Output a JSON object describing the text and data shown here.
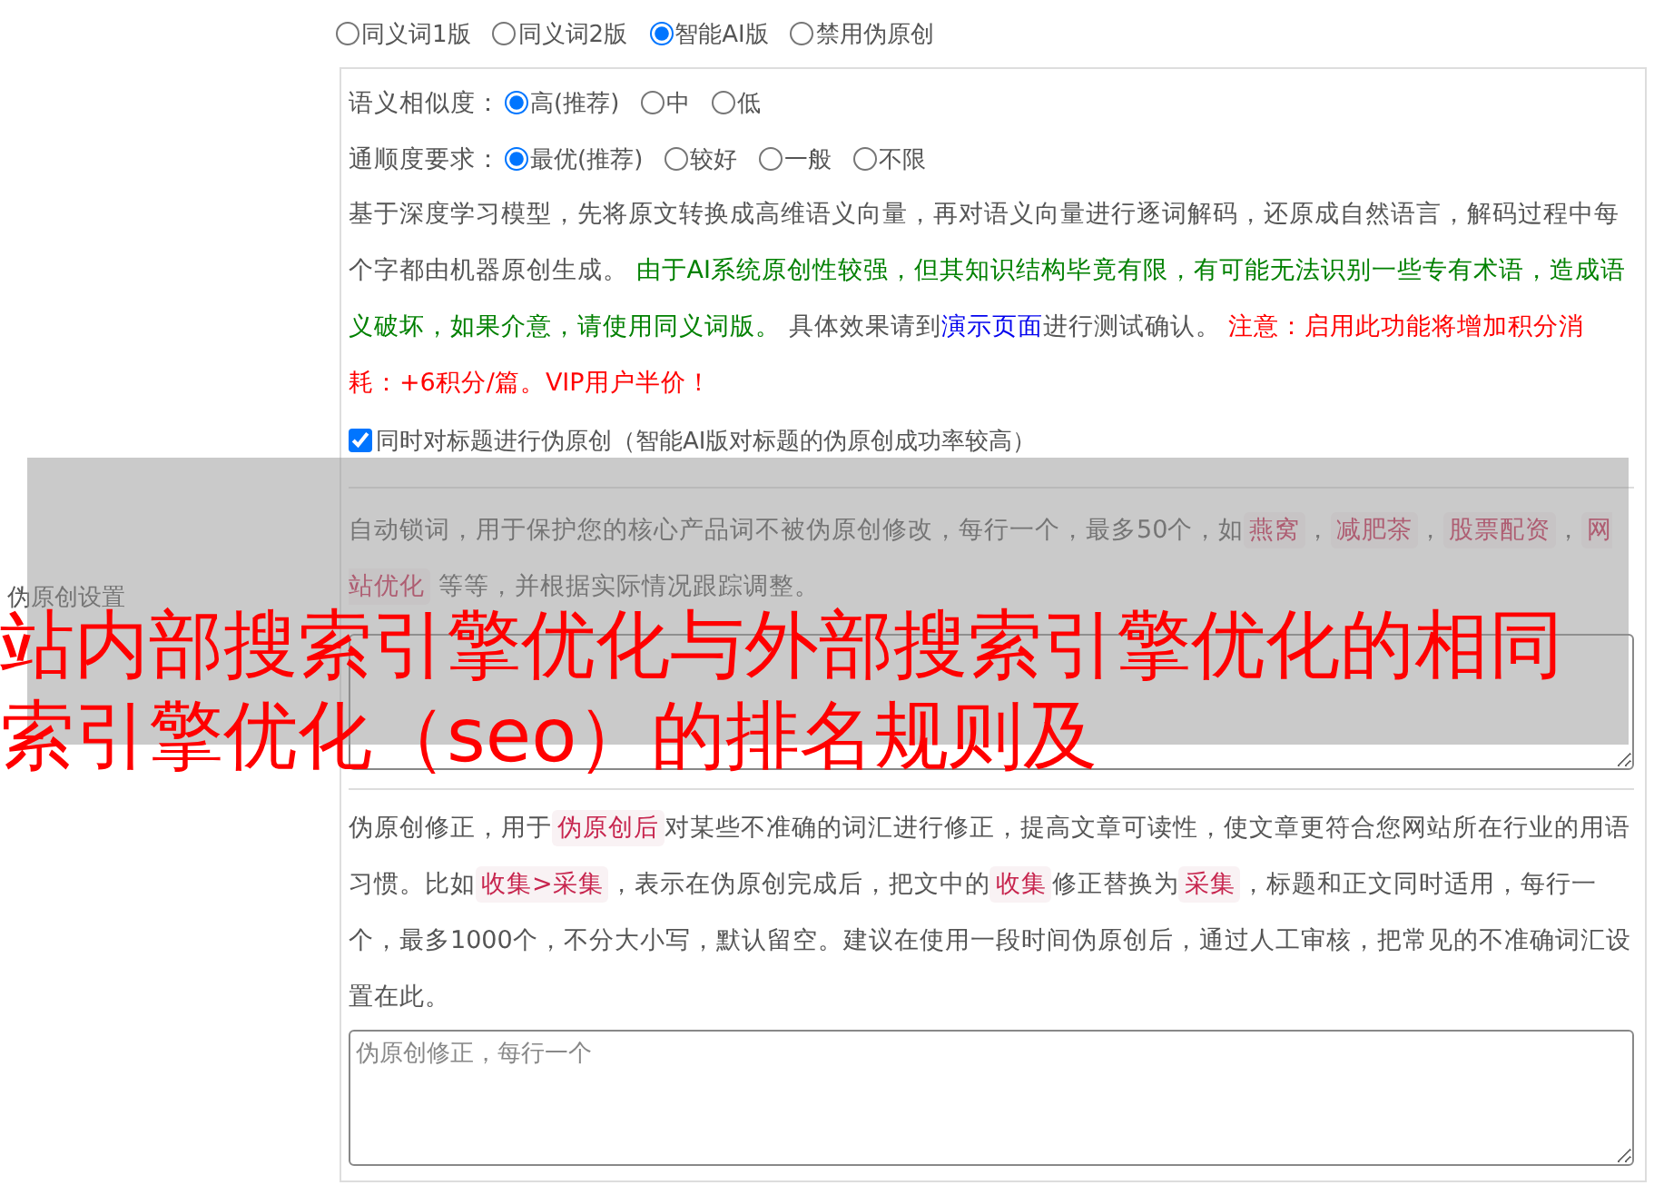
{
  "version_options": [
    {
      "label": "同义词1版",
      "selected": false
    },
    {
      "label": "同义词2版",
      "selected": false
    },
    {
      "label": "智能AI版",
      "selected": true
    },
    {
      "label": "禁用伪原创",
      "selected": false
    }
  ],
  "ai_settings": {
    "similarity": {
      "label": "语义相似度：",
      "options": [
        {
          "label": "高(推荐)",
          "selected": true
        },
        {
          "label": "中",
          "selected": false
        },
        {
          "label": "低",
          "selected": false
        }
      ]
    },
    "fluency": {
      "label": "通顺度要求：",
      "options": [
        {
          "label": "最优(推荐)",
          "selected": true
        },
        {
          "label": "较好",
          "selected": false
        },
        {
          "label": "一般",
          "selected": false
        },
        {
          "label": "不限",
          "selected": false
        }
      ]
    },
    "description": [
      {
        "kind": "plain",
        "text": "基于深度学习模型，先将原文转换成高维语义向量，再对语义向量进行逐词解码，还原成自然语言，解码过程中每个字都由机器原创生成。 "
      },
      {
        "kind": "note",
        "text": "由于AI系统原创性较强，但其知识结构毕竟有限，有可能无法识别一些专有术语，造成语义破坏，如果介意，请使用同义词版。"
      },
      {
        "kind": "plain",
        "text": " 具体效果请到"
      },
      {
        "kind": "link",
        "text": "演示页面"
      },
      {
        "kind": "plain",
        "text": "进行测试确认。 "
      },
      {
        "kind": "warning",
        "text": "注意：启用此功能将增加积分消耗：+6积分/篇。VIP用户半价！"
      }
    ],
    "title_option": {
      "label": "同时对标题进行伪原创（智能AI版对标题的伪原创成功率较高）",
      "checked": true
    }
  },
  "section_label": "伪原创设置",
  "lock_words": {
    "description": [
      {
        "kind": "plain",
        "text": "自动锁词，用于保护您的核心产品词不被伪原创修改，每行一个，最多50个，如"
      },
      {
        "kind": "tag",
        "text": "燕窝"
      },
      {
        "kind": "plain",
        "text": "，"
      },
      {
        "kind": "tag",
        "text": "减肥茶"
      },
      {
        "kind": "plain",
        "text": "，"
      },
      {
        "kind": "tag",
        "text": "股票配资"
      },
      {
        "kind": "plain",
        "text": "，"
      },
      {
        "kind": "tag",
        "text": "网站优化"
      },
      {
        "kind": "plain",
        "text": " 等等，并根据实际情况跟踪调整。"
      }
    ]
  },
  "corrections": {
    "description": [
      {
        "kind": "plain",
        "text": "伪原创修正，用于"
      },
      {
        "kind": "tag",
        "text": "伪原创后"
      },
      {
        "kind": "plain",
        "text": "对某些不准确的词汇进行修正，提高文章可读性，使文章更符合您网站所在行业的用语习惯。比如"
      },
      {
        "kind": "tag",
        "text": "收集>采集"
      },
      {
        "kind": "plain",
        "text": "，表示在伪原创完成后，把文中的"
      },
      {
        "kind": "tag",
        "text": "收集"
      },
      {
        "kind": "plain",
        "text": "修正替换为"
      },
      {
        "kind": "tag",
        "text": "采集"
      },
      {
        "kind": "plain",
        "text": "，标题和正文同时适用，每行一个，最多1000个，不分大小写，默认留空。建议在使用一段时间伪原创后，通过人工审核，把常见的不准确词汇设置在此。"
      }
    ],
    "textarea": {
      "placeholder": "伪原创修正，每行一个"
    }
  },
  "overlay": {
    "lines": [
      "站内部搜索引擎优化与外部搜索引擎优化的相同",
      "索引擎优化（seo）的排名规则及"
    ]
  }
}
